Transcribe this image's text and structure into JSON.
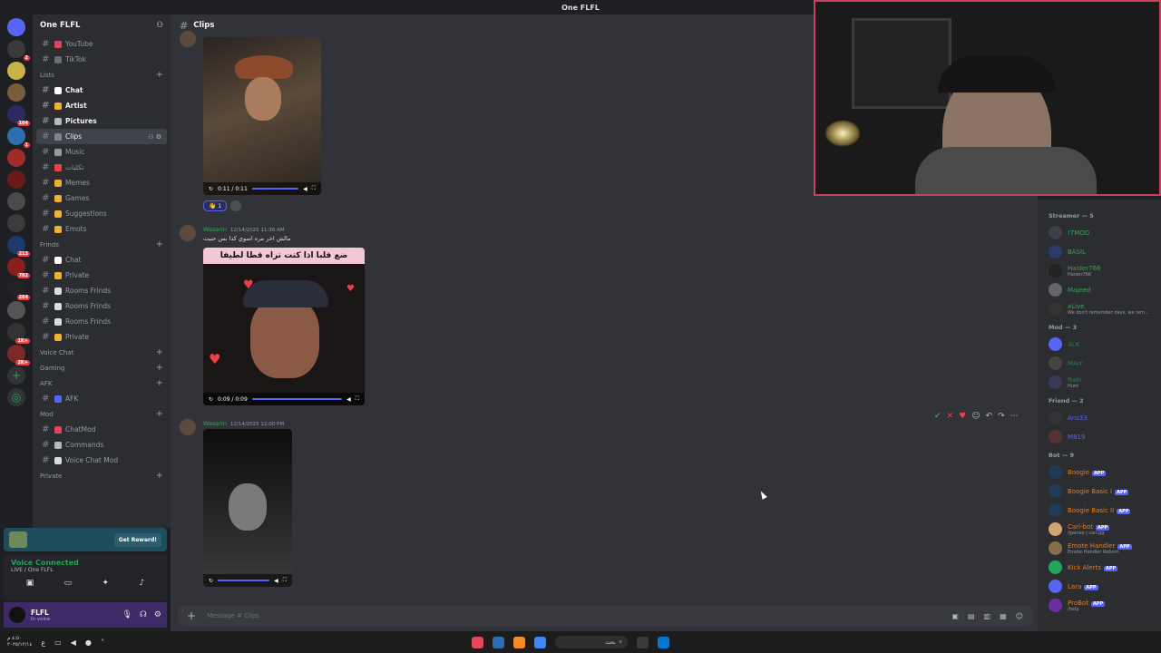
{
  "window": {
    "title": "One FLFL"
  },
  "server": {
    "name": "One FLFL"
  },
  "sidebar": {
    "top_channels": [
      {
        "label": "YouTube",
        "color": "#e0475b"
      },
      {
        "label": "TikTok",
        "color": "#6d6f78"
      }
    ],
    "categories": [
      {
        "label": "Lists",
        "channels": [
          {
            "label": "Chat",
            "color": "#ffffff",
            "bold": true
          },
          {
            "label": "Artist",
            "color": "#f0b232",
            "bold": true
          },
          {
            "label": "Pictures",
            "color": "#b5bac1",
            "bold": true
          },
          {
            "label": "Clips",
            "color": "#80848e",
            "active": true
          },
          {
            "label": "Music",
            "color": "#949ba4"
          },
          {
            "label": "تكليات",
            "color": "#f23f43"
          },
          {
            "label": "Memes",
            "color": "#f0b232"
          },
          {
            "label": "Games",
            "color": "#f0b232"
          },
          {
            "label": "Suggestions",
            "color": "#f0b232"
          },
          {
            "label": "Emots",
            "color": "#f0b232"
          }
        ]
      },
      {
        "label": "Frinds",
        "channels": [
          {
            "label": "Chat",
            "color": "#ffffff"
          },
          {
            "label": "Private",
            "color": "#f0b232"
          },
          {
            "label": "Rooms Frinds",
            "color": "#dbdee1"
          },
          {
            "label": "Rooms Frinds",
            "color": "#dbdee1"
          },
          {
            "label": "Rooms Frinds",
            "color": "#dbdee1"
          },
          {
            "label": "Private",
            "color": "#f0b232"
          }
        ]
      },
      {
        "label": "Voice Chat",
        "channels": []
      },
      {
        "label": "Gaming",
        "channels": []
      },
      {
        "label": "AFK",
        "channels": [
          {
            "label": "AFK",
            "color": "#5865f2"
          }
        ]
      },
      {
        "label": "Mod",
        "channels": [
          {
            "label": "ChatMod",
            "color": "#e0475b"
          },
          {
            "label": "Commands",
            "color": "#b5bac1"
          },
          {
            "label": "Voice Chat Mod",
            "color": "#dbdee1"
          }
        ]
      },
      {
        "label": "Private",
        "channels": []
      }
    ]
  },
  "promo": {
    "button": "Get Reward!"
  },
  "voice": {
    "status": "Voice Connected",
    "channel": "LIVE / One FLFL"
  },
  "user": {
    "name": "FLFL",
    "status": "In voice"
  },
  "channel": {
    "name": "Clips"
  },
  "messages": [
    {
      "video1_time": "0:11 / 0:11",
      "reaction_emoji": "👋",
      "reaction_count": "1"
    },
    {
      "author": "Wasarin",
      "timestamp": "12/14/2025 11:36 AM",
      "text": "مالش اخر مره اسوي كدا بس حبيت",
      "video_caption": "ضع قلبا اذا كنت تراه قطا لطيفا",
      "video_time": "0:09 / 0:09"
    },
    {
      "author": "Wasarin",
      "timestamp": "12/14/2025 12:00 PM"
    }
  ],
  "composer": {
    "placeholder": "Message #",
    "channel": "Clips"
  },
  "members": {
    "groups": [
      {
        "label": "Streamer — 5",
        "items": [
          {
            "name": "!7MOD",
            "color": "#3ba55d",
            "avatar": "#3a3f4a"
          },
          {
            "name": "BASIL",
            "color": "#3ba55d",
            "avatar": "#2a3a6a"
          },
          {
            "name": "Haider766",
            "color": "#3ba55d",
            "sub": "Haider766",
            "avatar": "#222"
          },
          {
            "name": "Majeed",
            "color": "#3ba55d",
            "avatar": "#666"
          },
          {
            "name": "xLive",
            "color": "#3ba55d",
            "sub": "We don't remember days, we rem...",
            "avatar": "#333"
          }
        ]
      },
      {
        "label": "Mod — 3",
        "items": [
          {
            "name": "ALK",
            "color": "#2d7d46",
            "avatar": "#5865f2"
          },
          {
            "name": "MArr",
            "color": "#2d7d46",
            "avatar": "#444"
          },
          {
            "name": "Raki",
            "color": "#2d7d46",
            "sub": "Hunt",
            "avatar": "#3a3a55"
          }
        ]
      },
      {
        "label": "Friend — 2",
        "items": [
          {
            "name": "Ans33",
            "color": "#5865f2",
            "avatar": "#333"
          },
          {
            "name": "M819",
            "color": "#5865f2",
            "avatar": "#553333"
          }
        ]
      },
      {
        "label": "Bot — 9",
        "items": [
          {
            "name": "Boogie",
            "color": "#e67e22",
            "tag": "APP",
            "avatar": "#1f3b57"
          },
          {
            "name": "Boogie Basic I",
            "color": "#e67e22",
            "tag": "APP",
            "avatar": "#1f3b57"
          },
          {
            "name": "Boogie Basic II",
            "color": "#e67e22",
            "tag": "APP",
            "avatar": "#1f3b57"
          },
          {
            "name": "Carl-bot",
            "color": "#e67e22",
            "tag": "APP",
            "sub": "/games | carl.gg",
            "avatar": "#d4a373"
          },
          {
            "name": "Emote Handler",
            "color": "#e67e22",
            "tag": "APP",
            "sub": "Emote Handler Reborn",
            "avatar": "#8a6d4a"
          },
          {
            "name": "Kick Alerts",
            "color": "#e67e22",
            "tag": "APP",
            "avatar": "#23a55a"
          },
          {
            "name": "Lara",
            "color": "#e67e22",
            "tag": "APP",
            "avatar": "#5865f2"
          },
          {
            "name": "ProBot",
            "color": "#e67e22",
            "tag": "APP",
            "sub": "/help",
            "avatar": "#6a2fa0"
          }
        ]
      }
    ]
  },
  "taskbar": {
    "time": "‎٤:٥٠ م",
    "date": "٢٠٢٥/١٢/١٤",
    "search": "بحث"
  },
  "colors": {
    "accent": "#5865f2",
    "online": "#23a55a",
    "cam_border": "#c9415f"
  }
}
